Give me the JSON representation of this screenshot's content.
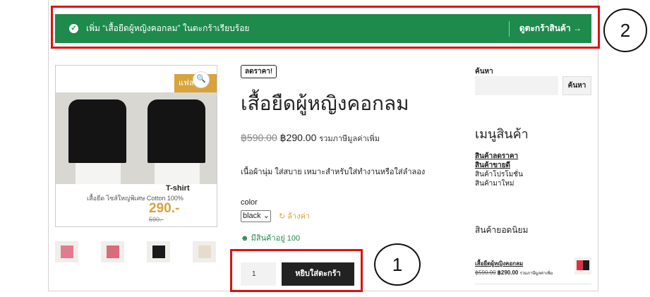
{
  "notice": {
    "message": "เพิ่ม “เสื้อยืดผู้หญิงคอกลม” ในตะกร้าเรียบร้อย",
    "cart_link": "ดูตะกร้าสินค้า →",
    "check_icon": "check-circle-icon",
    "color": "#1e8a4c"
  },
  "annotations": {
    "one": "1",
    "two": "2"
  },
  "gallery": {
    "sale_tag": "แฟลช",
    "zoom_icon": "magnifier-icon",
    "brand": "T-shirt",
    "desc": "เสื้อยืด ไซส์ใหญ่พิเศษ Cotton 100%",
    "price": "290.-",
    "old_price": "590.-"
  },
  "product": {
    "badge": "ลดราคา!",
    "title": "เสื้อยืดผู้หญิงคอกลม",
    "old_price": "฿590.00",
    "new_price": "฿290.00",
    "tax": "รวมภาษีมูลค่าเพิ่ม",
    "description": "เนื้อผ้านุ่ม ใส่สบาย เหมาะสำหรับใส่ทำงานหรือใส่ลำลอง",
    "color_label": "color",
    "color_value": "black ⌄",
    "clear": "ล้างค่า",
    "stock": "มีสินค้าอยู่ 100",
    "quantity": "1",
    "add_to_cart": "หยิบใส่ตะกร้า"
  },
  "sidebar": {
    "search_label": "ค้นหา",
    "search_button": "ค้นหา",
    "menu_title": "เมนูสินค้า",
    "menu_items": [
      "สินค้าลดราคา",
      "สินค้าขายดี",
      "สินค้าโปรโมชั่น",
      "สินค้ามาใหม่"
    ],
    "best_title": "สินค้ายอดนิยม",
    "best_item": {
      "name": "เสื้อยืดผู้หญิงคอกลม",
      "old_price": "฿590.00",
      "new_price": "฿290.00",
      "tax": "รวมภาษีมูลค่าเพิ่ม"
    }
  }
}
